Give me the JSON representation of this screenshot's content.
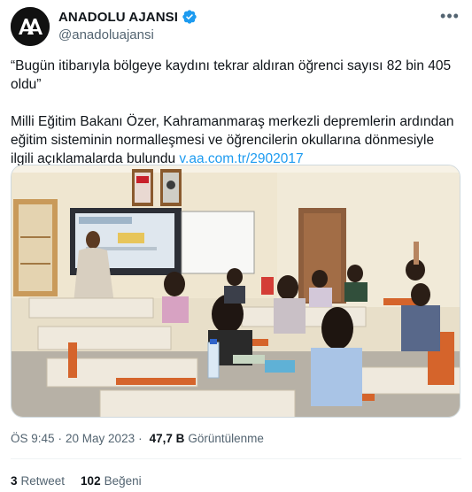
{
  "account": {
    "name": "ANADOLU AJANSI",
    "handle": "@anadoluajansi",
    "avatar_text": "AA"
  },
  "tweet": {
    "quote": "“Bugün itibarıyla bölgeye kaydını tekrar aldıran öğrenci sayısı 82 bin 405 oldu”",
    "body_line1": "Milli Eğitim Bakanı Özer, Kahramanmaraş merkezli depremlerin ardından",
    "body_line2": "eğitim sisteminin normalleşmesi ve öğrencilerin okullarına dönmesiyle",
    "body_line3": "ilgili açıklamalarda bulundu",
    "link": "v.aa.com.tr/2902017"
  },
  "meta": {
    "time": "ÖS 9:45",
    "date": "20 May 2023",
    "separator": "·",
    "views": "47,7 B",
    "views_label": "Görüntülenme"
  },
  "stats": {
    "retweets": "3",
    "retweets_label": "Retweet",
    "likes": "102",
    "likes_label": "Beğeni"
  },
  "colors": {
    "accent": "#1d9bf0",
    "text": "#0f1419",
    "muted": "#536471"
  }
}
